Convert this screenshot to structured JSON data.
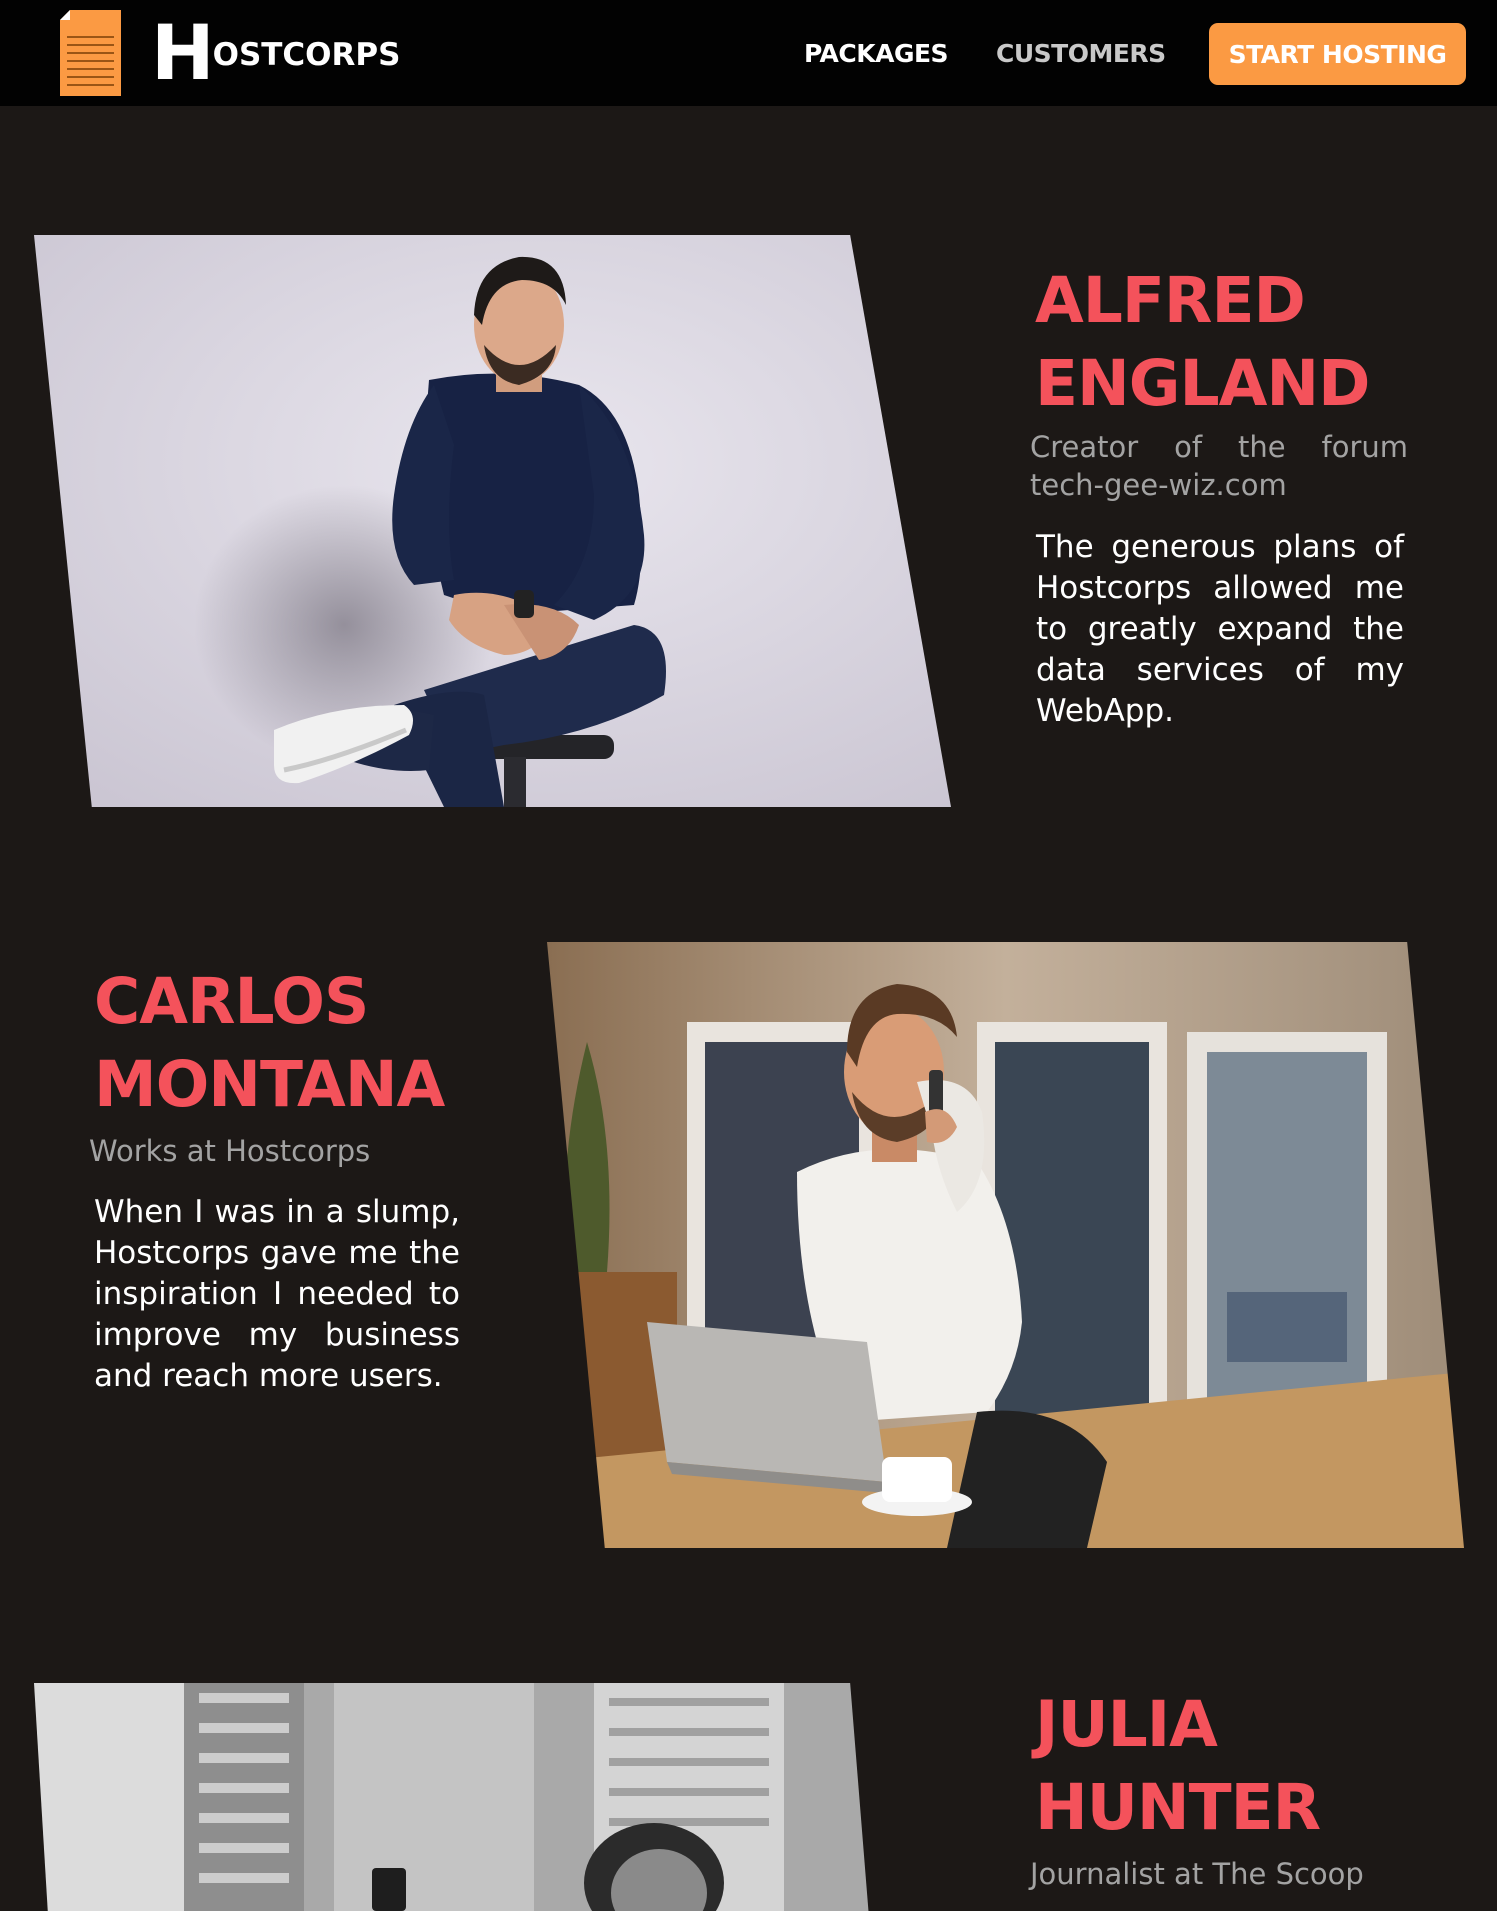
{
  "header": {
    "brand": {
      "initial": "H",
      "rest": "OSTCORPS"
    },
    "logo_icon": "document-icon",
    "nav": {
      "packages": "PACKAGES",
      "customers": "CUSTOMERS"
    },
    "cta": "START HOSTING"
  },
  "testimonials": [
    {
      "name_line1": "ALFRED",
      "name_line2": "ENGLAND",
      "role": "Creator of the forum tech-gee-wiz.com",
      "quote": "The generous plans of Hostcorps allowed me to greatly expand the data services of my WebApp."
    },
    {
      "name_line1": "CARLOS",
      "name_line2": "MONTANA",
      "role": "Works at Hostcorps",
      "quote": "When I was in a slump, Hostcorps gave me the inspiration I needed to improve my business and reach more users."
    },
    {
      "name_line1": "JULIA",
      "name_line2": "HUNTER",
      "role": "Journalist at The Scoop",
      "quote": ""
    }
  ],
  "colors": {
    "background": "#1c1816",
    "navbar": "#020202",
    "accent_orange": "#fb9a43",
    "name_red": "#f4525b",
    "role_gray": "#a3a3a3",
    "quote_white": "#ffffff"
  }
}
